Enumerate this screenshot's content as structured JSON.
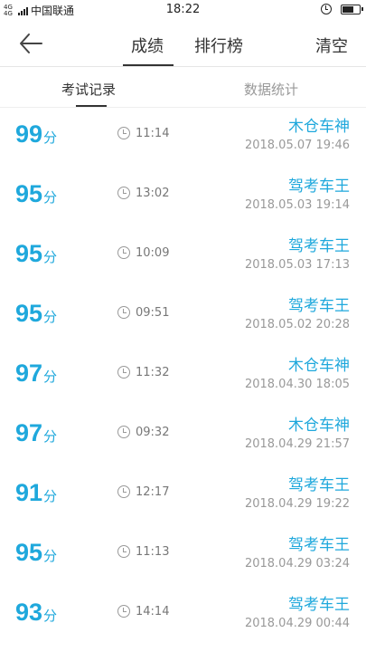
{
  "status_bar": {
    "network": "4G 4G",
    "carrier": "中国联通",
    "time": "18:22"
  },
  "nav": {
    "tab_scores": "成绩",
    "tab_rank": "排行榜",
    "clear": "清空"
  },
  "sub_tabs": {
    "records": "考试记录",
    "stats": "数据统计"
  },
  "score_unit": "分",
  "records": [
    {
      "score": "99",
      "duration": "11:14",
      "title": "木仓车神",
      "date": "2018.05.07",
      "time": "19:46"
    },
    {
      "score": "95",
      "duration": "13:02",
      "title": "驾考车王",
      "date": "2018.05.03",
      "time": "19:14"
    },
    {
      "score": "95",
      "duration": "10:09",
      "title": "驾考车王",
      "date": "2018.05.03",
      "time": "17:13"
    },
    {
      "score": "95",
      "duration": "09:51",
      "title": "驾考车王",
      "date": "2018.05.02",
      "time": "20:28"
    },
    {
      "score": "97",
      "duration": "11:32",
      "title": "木仓车神",
      "date": "2018.04.30",
      "time": "18:05"
    },
    {
      "score": "97",
      "duration": "09:32",
      "title": "木仓车神",
      "date": "2018.04.29",
      "time": "21:57"
    },
    {
      "score": "91",
      "duration": "12:17",
      "title": "驾考车王",
      "date": "2018.04.29",
      "time": "19:22"
    },
    {
      "score": "95",
      "duration": "11:13",
      "title": "驾考车王",
      "date": "2018.04.29",
      "time": "03:24"
    },
    {
      "score": "93",
      "duration": "14:14",
      "title": "驾考车王",
      "date": "2018.04.29",
      "time": "00:44"
    }
  ],
  "colors": {
    "accent": "#1fa8dc",
    "muted": "#999999"
  }
}
